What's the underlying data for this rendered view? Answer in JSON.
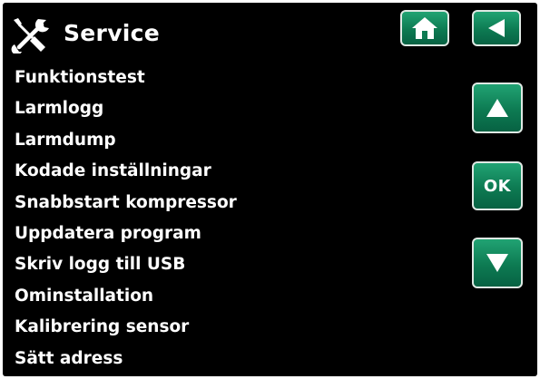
{
  "header": {
    "title": "Service",
    "title_icon": "wrench-screwdriver-icon",
    "home_icon": "home-icon",
    "back_icon": "back-arrow-icon"
  },
  "menu": {
    "items": [
      {
        "label": "Funktionstest"
      },
      {
        "label": "Larmlogg"
      },
      {
        "label": "Larmdump"
      },
      {
        "label": "Kodade inställningar"
      },
      {
        "label": "Snabbstart kompressor"
      },
      {
        "label": "Uppdatera program"
      },
      {
        "label": "Skriv logg till USB"
      },
      {
        "label": "Ominstallation"
      },
      {
        "label": "Kalibrering sensor"
      },
      {
        "label": "Sätt adress"
      }
    ]
  },
  "controls": {
    "up_icon": "arrow-up-icon",
    "ok_label": "OK",
    "down_icon": "arrow-down-icon"
  },
  "colors": {
    "background": "#000000",
    "text": "#ffffff",
    "button_green": "#1a9166",
    "button_border": "#dfe9e4"
  }
}
